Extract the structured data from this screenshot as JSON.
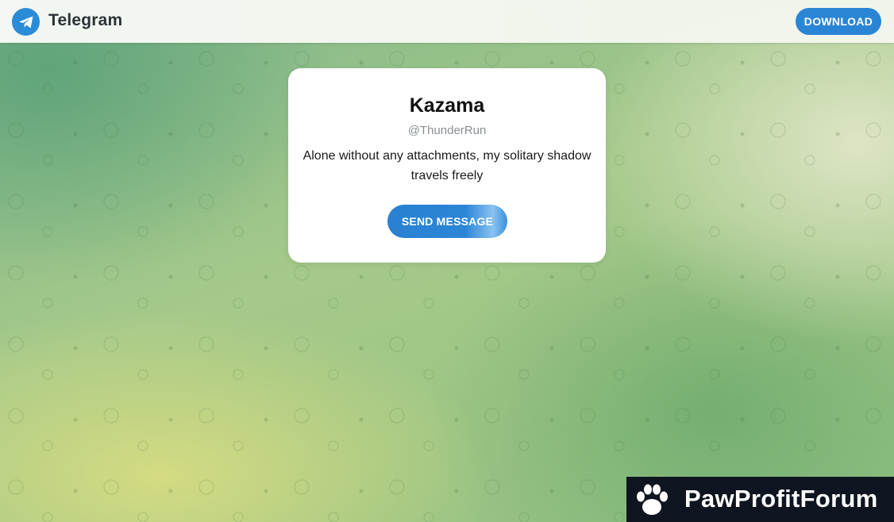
{
  "header": {
    "brand": "Telegram",
    "download_label": "DOWNLOAD"
  },
  "profile": {
    "name": "Kazama",
    "username": "@ThunderRun",
    "bio": "Alone without any attachments, my solitary shadow travels freely",
    "send_label": "SEND MESSAGE"
  },
  "watermark": {
    "text": "PawProfitForum"
  },
  "icons": {
    "logo": "telegram-plane-icon",
    "watermark": "paw-icon"
  },
  "colors": {
    "accent": "#2a85d4",
    "brand_text": "#2c3338",
    "watermark_bg": "#0f1520"
  }
}
